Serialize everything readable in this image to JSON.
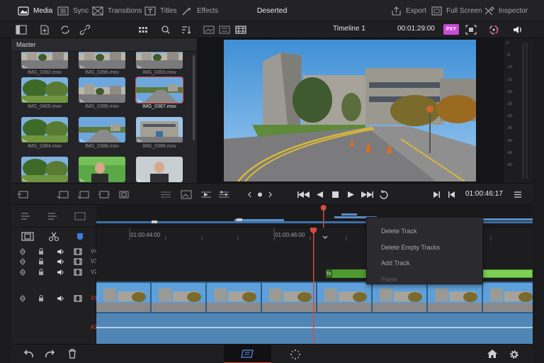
{
  "topbar": {
    "tabs": [
      {
        "label": "Media",
        "icon": "media-icon",
        "active": true
      },
      {
        "label": "Sync",
        "icon": "sync-icon",
        "active": false
      },
      {
        "label": "Transitions",
        "icon": "transitions-icon",
        "active": false
      },
      {
        "label": "Titles",
        "icon": "titles-icon",
        "active": false
      },
      {
        "label": "Effects",
        "icon": "effects-icon",
        "active": false
      }
    ],
    "project_title": "Deserted",
    "export_label": "Export",
    "fullscreen_label": "Full Screen",
    "inspector_label": "Inspector"
  },
  "viewer_toolbar": {
    "timeline_name": "Timeline 1",
    "timecode": "00:01:29:00",
    "badge": "PXY"
  },
  "media_pool": {
    "bin": "Master",
    "clips": [
      {
        "name": "IMG_0392.mov",
        "scene": "street",
        "selected": false
      },
      {
        "name": "IMG_0396.mov",
        "scene": "street",
        "selected": false
      },
      {
        "name": "IMG_0393.mov",
        "scene": "street",
        "selected": false
      },
      {
        "name": "IMG_0405.mov",
        "scene": "garden",
        "selected": false
      },
      {
        "name": "IMG_0395.mov",
        "scene": "street",
        "selected": false
      },
      {
        "name": "IMG_0367.mov",
        "scene": "road",
        "selected": true
      },
      {
        "name": "IMG_0384.mov",
        "scene": "garden",
        "selected": false
      },
      {
        "name": "IMG_0388.mov",
        "scene": "road",
        "selected": false
      },
      {
        "name": "IMG_0389.mov",
        "scene": "building",
        "selected": false
      },
      {
        "name": "",
        "scene": "garden",
        "selected": false
      },
      {
        "name": "",
        "scene": "person",
        "selected": false
      },
      {
        "name": "",
        "scene": "person-light",
        "selected": false
      }
    ]
  },
  "meter": {
    "ticks": [
      "0",
      "-5",
      "-10",
      "-15",
      "-20",
      "-25",
      "-30",
      "-35",
      "-40",
      "-45",
      "-50"
    ]
  },
  "transport": {
    "current_timecode": "01:00:46:17"
  },
  "timeline": {
    "ruler": [
      "01:00:44:00",
      "01:00:46:00"
    ],
    "tracks": [
      {
        "label": "V4",
        "type": "video"
      },
      {
        "label": "V3",
        "type": "video"
      },
      {
        "label": "V2",
        "type": "video"
      },
      {
        "label": "V1",
        "type": "video"
      },
      {
        "label": "A1",
        "type": "audio"
      }
    ],
    "fx_badge": "fx"
  },
  "context_menu": {
    "items": [
      {
        "label": "Delete Track",
        "enabled": true
      },
      {
        "label": "Delete Empty Tracks",
        "enabled": true
      },
      {
        "label": "Add Track",
        "enabled": true
      },
      {
        "label": "Paste",
        "enabled": false
      }
    ]
  },
  "colors": {
    "accent": "#d64a3e",
    "audio_track": "#4f86b5",
    "clip_green": "#4f9a2f"
  }
}
